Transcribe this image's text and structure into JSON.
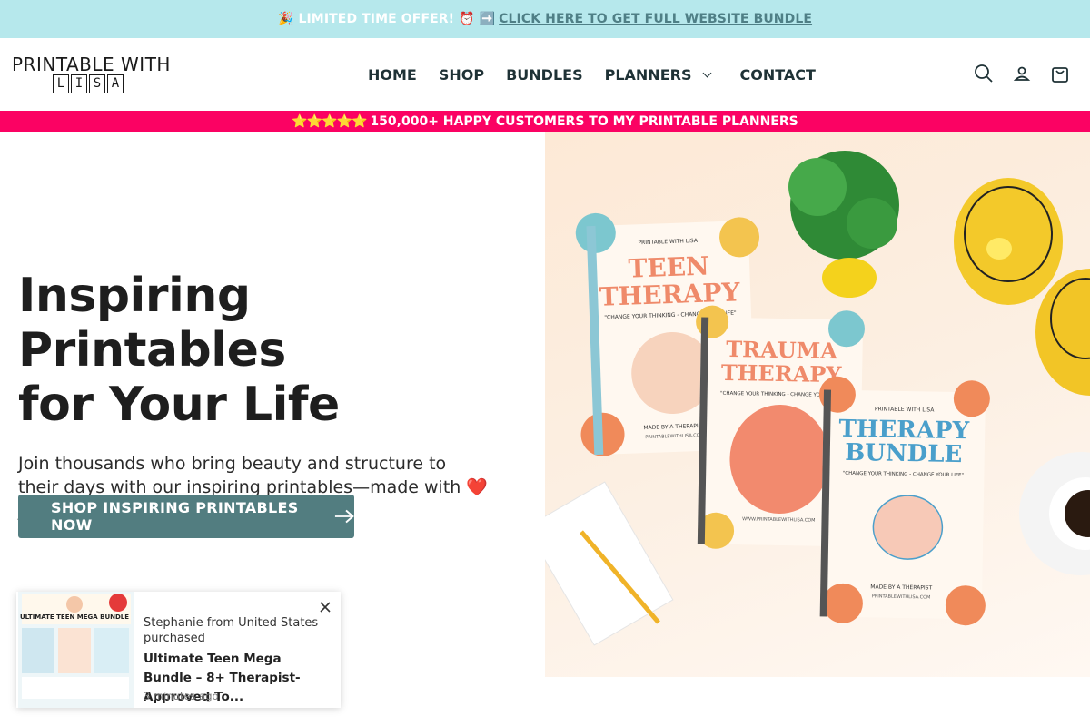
{
  "announcement": {
    "prefix": "🎉 LIMITED TIME OFFER! ⏰ ➡️",
    "link": "CLICK HERE TO GET FULL WEBSITE BUNDLE"
  },
  "logo": {
    "line1": "PRINTABLE WITH",
    "letters": [
      "L",
      "I",
      "S",
      "A"
    ]
  },
  "nav": {
    "items": [
      "HOME",
      "SHOP",
      "BUNDLES",
      "PLANNERS",
      "CONTACT"
    ]
  },
  "header_icons": [
    "search-icon",
    "account-icon",
    "cart-icon"
  ],
  "promo_bar": {
    "stars": "⭐⭐⭐⭐⭐",
    "text": "150,000+ HAPPY CUSTOMERS TO MY PRINTABLE PLANNERS"
  },
  "hero": {
    "title_line1": "Inspiring Printables",
    "title_line2": "for Your Life",
    "subtitle": "Join thousands who bring beauty and structure to their days with our inspiring printables—made with ❤️ just for you.",
    "cta": "SHOP INSPIRING PRINTABLES NOW"
  },
  "hero_image": {
    "books": [
      {
        "brand": "PRINTABLE WITH LISA",
        "title1": "TEEN",
        "title2": "THERAPY",
        "tagline": "\"CHANGE YOUR THINKING - CHANGE YOUR LIFE\"",
        "footer": "MADE BY A THERAPIST",
        "url": "PRINTABLEWITHLISA.COM"
      },
      {
        "title1": "TRAUMA",
        "title2": "THERAPY",
        "tagline": "\"CHANGE YOUR THINKING - CHANGE YOUR LIFE\"",
        "url": "WWW.PRINTABLEWITHLISA.COM"
      },
      {
        "brand": "PRINTABLE WITH LISA",
        "title1": "THERAPY",
        "title2": "BUNDLE",
        "tagline": "\"CHANGE YOUR THINKING - CHANGE YOUR LIFE\"",
        "footer": "MADE BY A THERAPIST",
        "url": "PRINTABLEWITHLISA.COM"
      }
    ]
  },
  "toast": {
    "thumb_title": "ULTIMATE TEEN MEGA BUNDLE",
    "who": "Stephanie from United States purchased",
    "product": "Ultimate Teen Mega Bundle – 8+ Therapist-Approved To...",
    "time": "3 minutes ago"
  },
  "colors": {
    "announce_bg": "#b6e8ec",
    "promo_bg": "#fb0263",
    "cta_bg": "#527d80",
    "book_coral": "#ef8a6a",
    "book_blue": "#5aa9cf"
  }
}
